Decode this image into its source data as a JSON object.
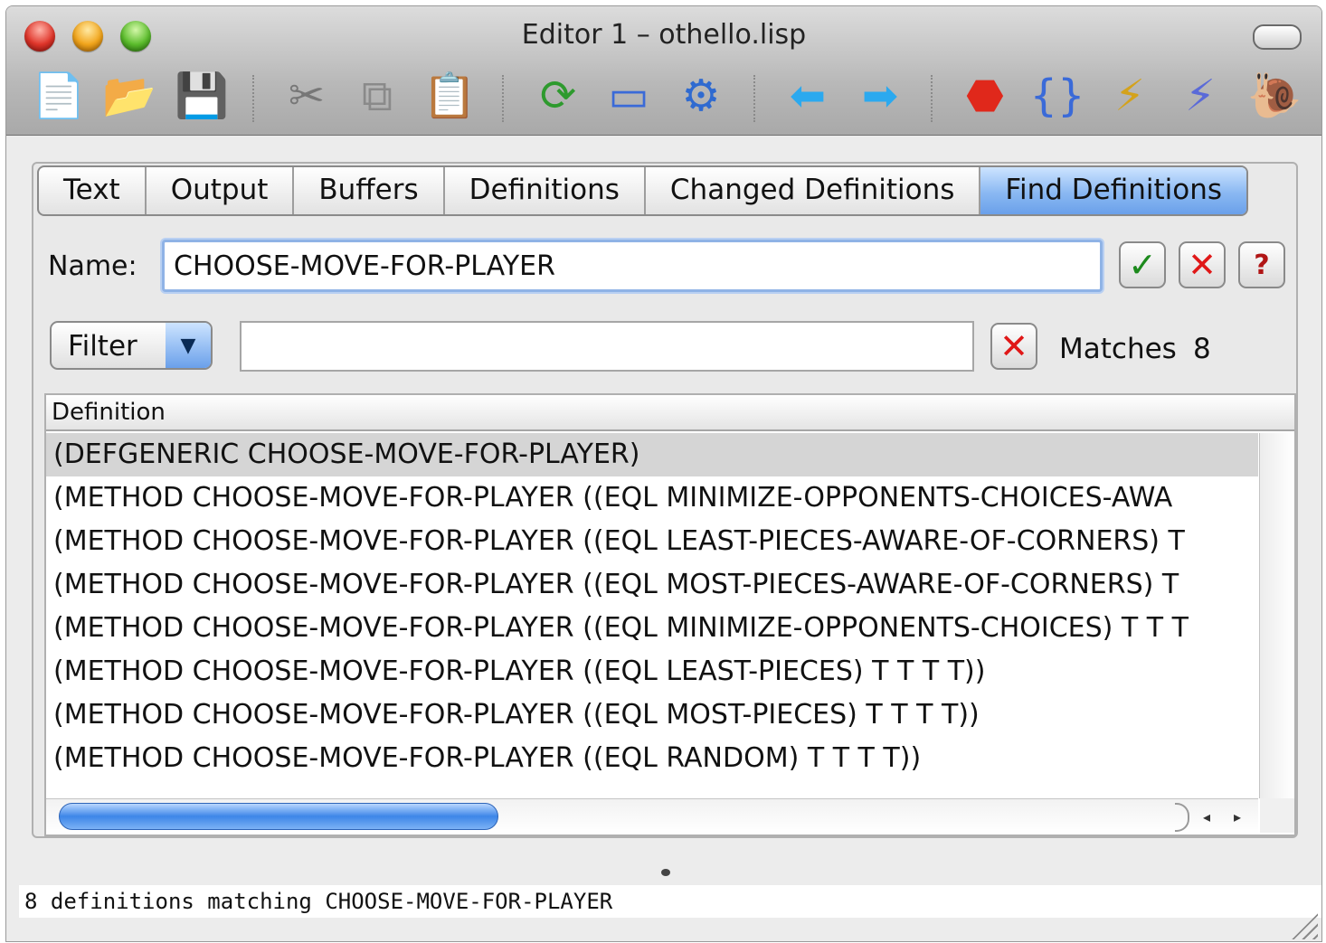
{
  "window": {
    "title": "Editor 1 – othello.lisp"
  },
  "toolbar": {
    "icons": [
      {
        "name": "new-document-icon",
        "glyph": "📄"
      },
      {
        "name": "open-folder-icon",
        "glyph": "📂"
      },
      {
        "name": "save-icon",
        "glyph": "💾"
      },
      {
        "name": "cut-icon",
        "glyph": "✂"
      },
      {
        "name": "copy-icon",
        "glyph": "⧉"
      },
      {
        "name": "paste-icon",
        "glyph": "📋"
      },
      {
        "name": "refresh-icon",
        "glyph": "⟳"
      },
      {
        "name": "window-icon",
        "glyph": "▭"
      },
      {
        "name": "tools-icon",
        "glyph": "⚙"
      },
      {
        "name": "back-arrow-icon",
        "glyph": "⬅"
      },
      {
        "name": "forward-arrow-icon",
        "glyph": "➡"
      },
      {
        "name": "stop-icon",
        "glyph": "⬣"
      },
      {
        "name": "compile-icon",
        "glyph": "{}"
      },
      {
        "name": "profile-icon",
        "glyph": "⚡"
      },
      {
        "name": "trace-icon",
        "glyph": "⚡"
      },
      {
        "name": "step-icon",
        "glyph": "🐌"
      }
    ]
  },
  "tabs": [
    {
      "label": "Text",
      "active": false
    },
    {
      "label": "Output",
      "active": false
    },
    {
      "label": "Buffers",
      "active": false
    },
    {
      "label": "Definitions",
      "active": false
    },
    {
      "label": "Changed Definitions",
      "active": false
    },
    {
      "label": "Find Definitions",
      "active": true
    }
  ],
  "find": {
    "name_label": "Name:",
    "name_value": "CHOOSE-MOVE-FOR-PLAYER",
    "confirm_glyph": "✓",
    "cancel_glyph": "✕",
    "help_glyph": "?",
    "filter_label": "Filter",
    "filter_arrow": "▼",
    "filter_value": "",
    "filter_clear_glyph": "✕",
    "matches_label": "Matches",
    "matches_count": "8"
  },
  "results": {
    "column_header": "Definition",
    "rows": [
      "(DEFGENERIC CHOOSE-MOVE-FOR-PLAYER)",
      "(METHOD CHOOSE-MOVE-FOR-PLAYER ((EQL MINIMIZE-OPPONENTS-CHOICES-AWA",
      "(METHOD CHOOSE-MOVE-FOR-PLAYER ((EQL LEAST-PIECES-AWARE-OF-CORNERS) T",
      "(METHOD CHOOSE-MOVE-FOR-PLAYER ((EQL MOST-PIECES-AWARE-OF-CORNERS) T",
      "(METHOD CHOOSE-MOVE-FOR-PLAYER ((EQL MINIMIZE-OPPONENTS-CHOICES) T T T",
      "(METHOD CHOOSE-MOVE-FOR-PLAYER ((EQL LEAST-PIECES) T T T T))",
      "(METHOD CHOOSE-MOVE-FOR-PLAYER ((EQL MOST-PIECES) T T T T))",
      "(METHOD CHOOSE-MOVE-FOR-PLAYER ((EQL RANDOM) T T T T))"
    ],
    "selected_index": 0,
    "scroll_left_arrow": "◂",
    "scroll_right_arrow": "▸"
  },
  "status": {
    "message": "8 definitions matching CHOOSE-MOVE-FOR-PLAYER"
  }
}
